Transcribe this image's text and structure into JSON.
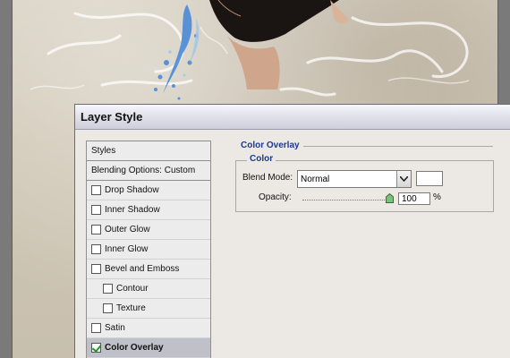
{
  "dialog": {
    "title": "Layer Style",
    "styles_list": {
      "header": "Styles",
      "blending_options": "Blending Options: Custom",
      "items": [
        {
          "label": "Drop Shadow",
          "checked": false,
          "indent": false,
          "selected": false
        },
        {
          "label": "Inner Shadow",
          "checked": false,
          "indent": false,
          "selected": false
        },
        {
          "label": "Outer Glow",
          "checked": false,
          "indent": false,
          "selected": false
        },
        {
          "label": "Inner Glow",
          "checked": false,
          "indent": false,
          "selected": false
        },
        {
          "label": "Bevel and Emboss",
          "checked": false,
          "indent": false,
          "selected": false
        },
        {
          "label": "Contour",
          "checked": false,
          "indent": true,
          "selected": false
        },
        {
          "label": "Texture",
          "checked": false,
          "indent": true,
          "selected": false
        },
        {
          "label": "Satin",
          "checked": false,
          "indent": false,
          "selected": false
        },
        {
          "label": "Color Overlay",
          "checked": true,
          "indent": false,
          "selected": true
        }
      ]
    },
    "color_overlay": {
      "section_title": "Color Overlay",
      "group_title": "Color",
      "blend_mode_label": "Blend Mode:",
      "blend_mode_value": "Normal",
      "overlay_color": "#ffffff",
      "opacity_label": "Opacity:",
      "opacity_value": "100",
      "opacity_unit": "%"
    }
  },
  "colors": {
    "section_title": "#1a3a8a",
    "selected_item_bg": "#bfc0c8",
    "checkmark": "#1a9a1a"
  }
}
